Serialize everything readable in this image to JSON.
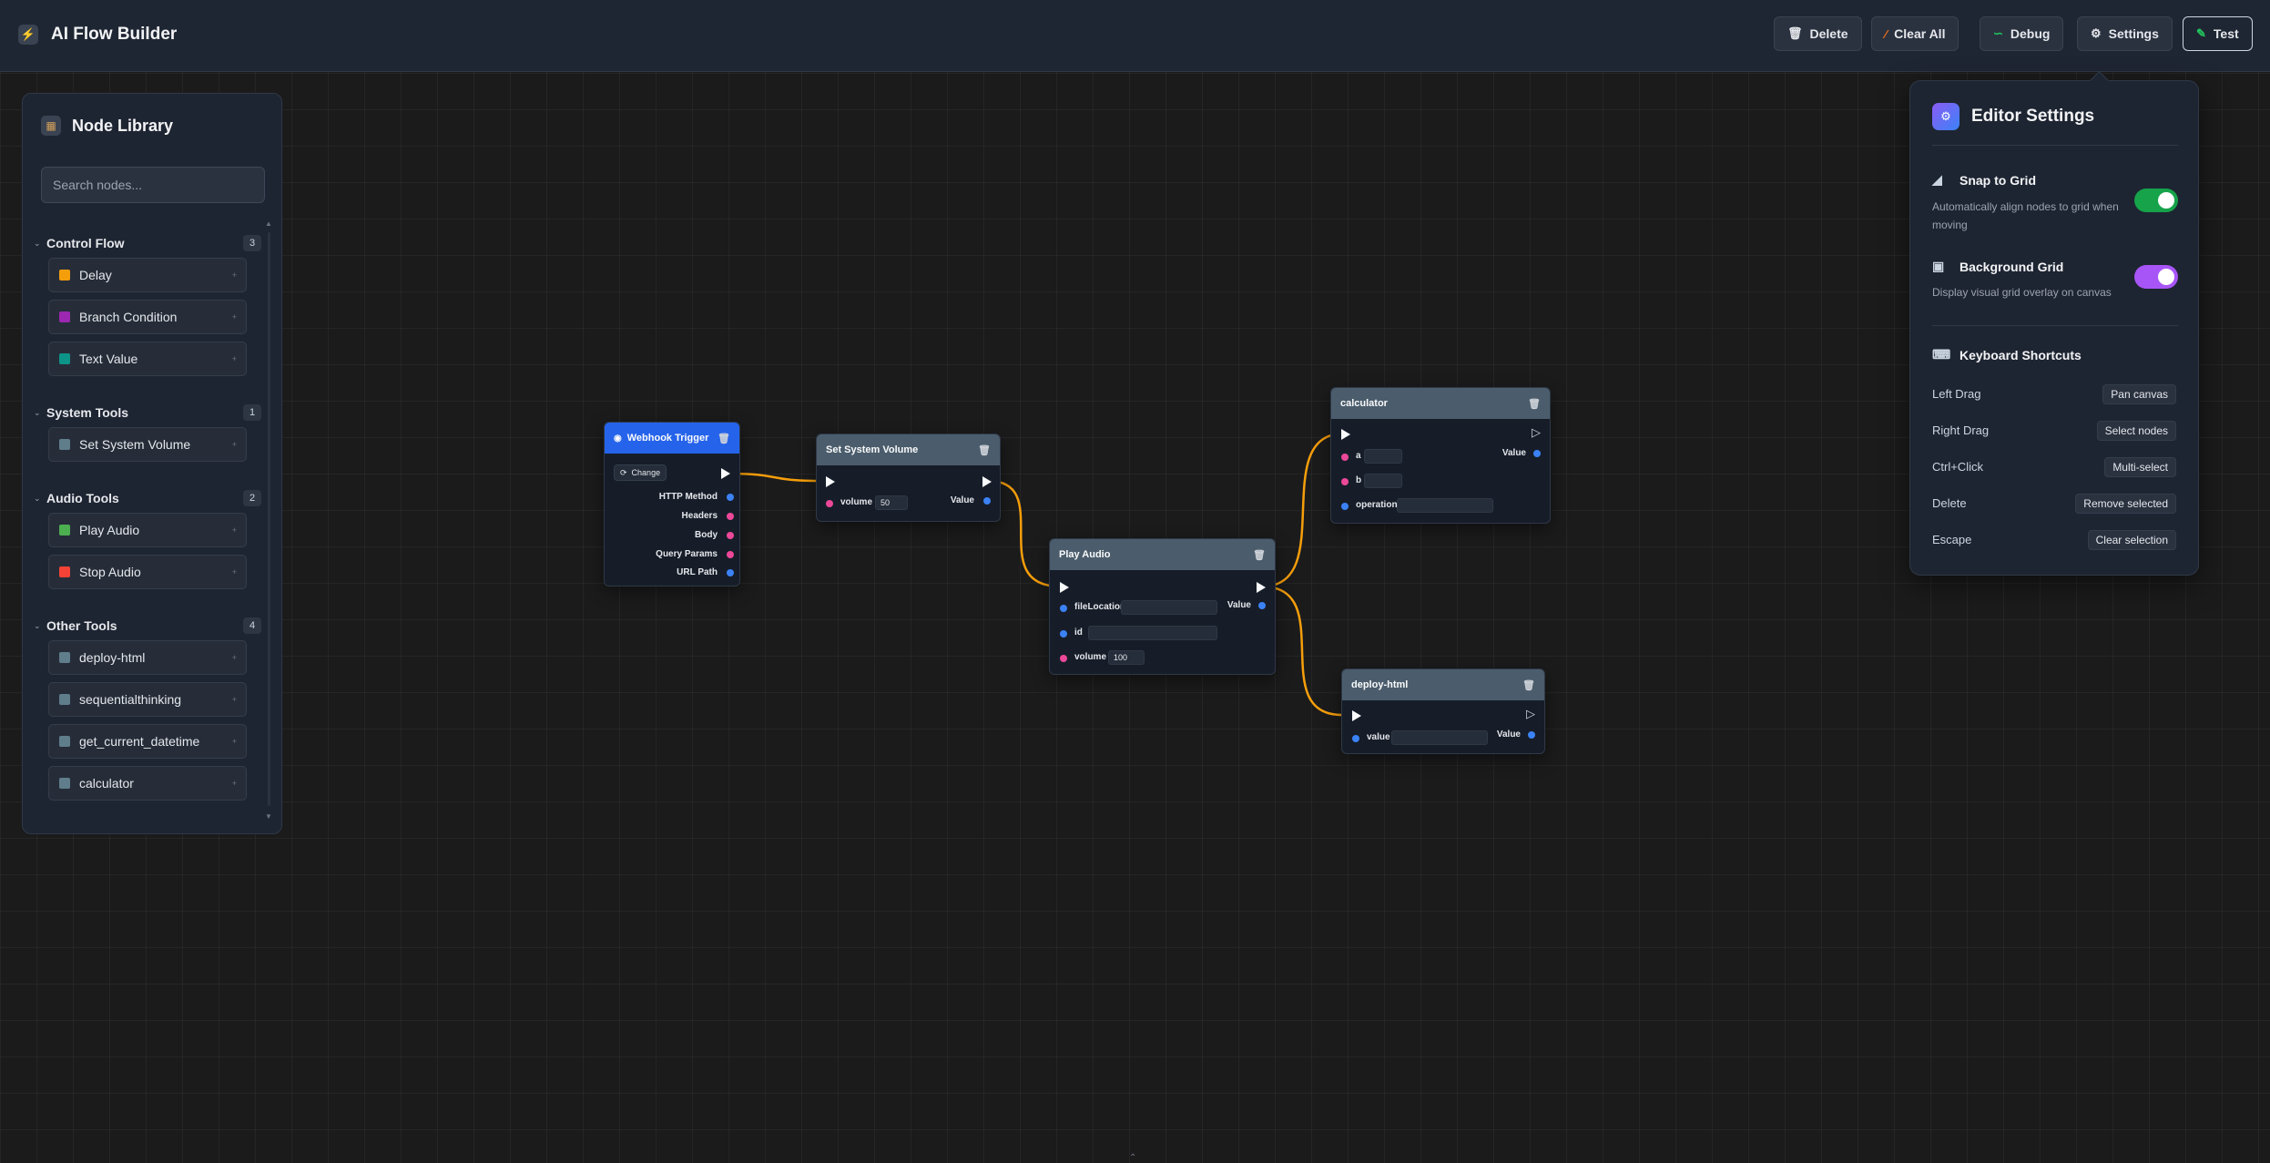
{
  "header": {
    "title": "AI Flow Builder",
    "buttons": {
      "delete": "Delete",
      "clear_all": "Clear All",
      "debug": "Debug",
      "settings": "Settings",
      "test": "Test"
    }
  },
  "library": {
    "title": "Node Library",
    "search_placeholder": "Search nodes...",
    "categories": [
      {
        "name": "Control Flow",
        "count": "3",
        "items": [
          {
            "label": "Delay",
            "color": "#f59e0b"
          },
          {
            "label": "Branch Condition",
            "color": "#9c27b0"
          },
          {
            "label": "Text Value",
            "color": "#0d9488"
          }
        ]
      },
      {
        "name": "System Tools",
        "count": "1",
        "items": [
          {
            "label": "Set System Volume",
            "color": "#607d8b"
          }
        ]
      },
      {
        "name": "Audio Tools",
        "count": "2",
        "items": [
          {
            "label": "Play Audio",
            "color": "#4caf50"
          },
          {
            "label": "Stop Audio",
            "color": "#f44336"
          }
        ]
      },
      {
        "name": "Other Tools",
        "count": "4",
        "items": [
          {
            "label": "deploy-html",
            "color": "#607d8b"
          },
          {
            "label": "sequentialthinking",
            "color": "#607d8b"
          },
          {
            "label": "get_current_datetime",
            "color": "#607d8b"
          },
          {
            "label": "calculator",
            "color": "#607d8b"
          }
        ]
      }
    ]
  },
  "nodes": {
    "webhook": {
      "title": "Webhook Trigger",
      "change_label": "Change",
      "outputs": [
        "HTTP Method",
        "Headers",
        "Body",
        "Query Params",
        "URL Path"
      ]
    },
    "set_volume": {
      "title": "Set System Volume",
      "input_label": "volume",
      "input_value": "50",
      "output_label": "Value"
    },
    "play_audio": {
      "title": "Play Audio",
      "inputs": [
        {
          "label": "fileLocation",
          "value": ""
        },
        {
          "label": "id",
          "value": ""
        },
        {
          "label": "volume",
          "value": "100"
        }
      ],
      "output_label": "Value"
    },
    "calculator": {
      "title": "calculator",
      "inputs": [
        {
          "label": "a",
          "value": ""
        },
        {
          "label": "b",
          "value": ""
        },
        {
          "label": "operation",
          "value": ""
        }
      ],
      "output_label": "Value"
    },
    "deploy_html": {
      "title": "deploy-html",
      "input_label": "value",
      "input_value": "",
      "output_label": "Value"
    }
  },
  "settings": {
    "title": "Editor Settings",
    "snap": {
      "title": "Snap to Grid",
      "desc": "Automatically align nodes to grid when moving",
      "enabled": true
    },
    "grid": {
      "title": "Background Grid",
      "desc": "Display visual grid overlay on canvas",
      "enabled": true
    },
    "shortcuts_title": "Keyboard Shortcuts",
    "shortcuts": [
      {
        "key": "Left Drag",
        "action": "Pan canvas"
      },
      {
        "key": "Right Drag",
        "action": "Select nodes"
      },
      {
        "key": "Ctrl+Click",
        "action": "Multi-select"
      },
      {
        "key": "Delete",
        "action": "Remove selected"
      },
      {
        "key": "Escape",
        "action": "Clear selection"
      }
    ]
  },
  "colors": {
    "accent_wire": "#f59e0b",
    "pin_blue": "#3b82f6",
    "pin_pink": "#ec4899",
    "toggle_green": "#16a34a",
    "toggle_purple": "#a855f7"
  }
}
